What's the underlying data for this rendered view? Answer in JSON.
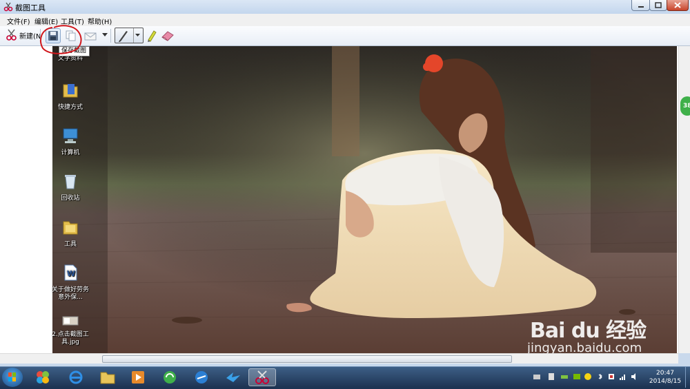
{
  "window": {
    "title": "截图工具"
  },
  "menu": {
    "file": "文件(F)",
    "edit": "编辑(E)",
    "tools": "工具(T)",
    "help": "帮助(H)"
  },
  "toolbar": {
    "new_label": "新建(N",
    "save_tooltip": "保存截图"
  },
  "desktop_icons": [
    {
      "label": "文字资料"
    },
    {
      "label": "快捷方式"
    },
    {
      "label": "计算机"
    },
    {
      "label": "回收站"
    },
    {
      "label": "工具"
    },
    {
      "label": "关于做好劳务意外保..."
    },
    {
      "label": "2.点击截图工具.jpg"
    }
  ],
  "watermark": {
    "logo": "Bai du 经验",
    "url": "jingyan.baidu.com"
  },
  "side_badge": "38",
  "taskbar": {
    "time": "20:47",
    "date": "2014/8/15"
  },
  "colors": {
    "accent": "#3a6ea5",
    "annotation_circle": "#d0161b",
    "close_button": "#c8442a"
  }
}
